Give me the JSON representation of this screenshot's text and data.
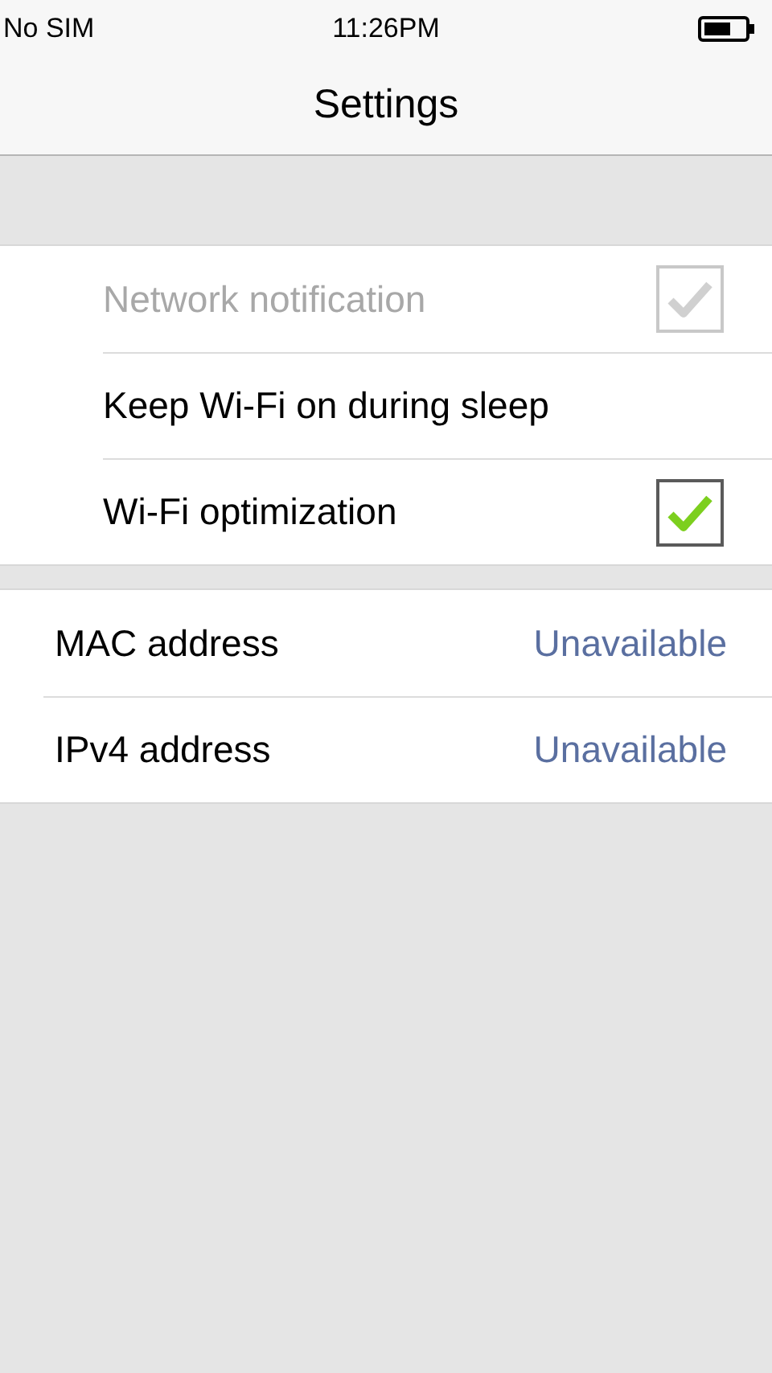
{
  "status_bar": {
    "carrier": "No SIM",
    "time": "11:26PM"
  },
  "title": "Settings",
  "wifi_options": [
    {
      "kind": "checkbox",
      "label": "Network notification",
      "checked": true,
      "disabled": true
    },
    {
      "kind": "plain",
      "label": "Keep Wi-Fi on during sleep",
      "disabled": false
    },
    {
      "kind": "checkbox",
      "label": "Wi-Fi optimization",
      "checked": true,
      "disabled": false
    }
  ],
  "addresses": [
    {
      "label": "MAC address",
      "value": "Unavailable"
    },
    {
      "label": "IPv4 address",
      "value": "Unavailable"
    }
  ]
}
